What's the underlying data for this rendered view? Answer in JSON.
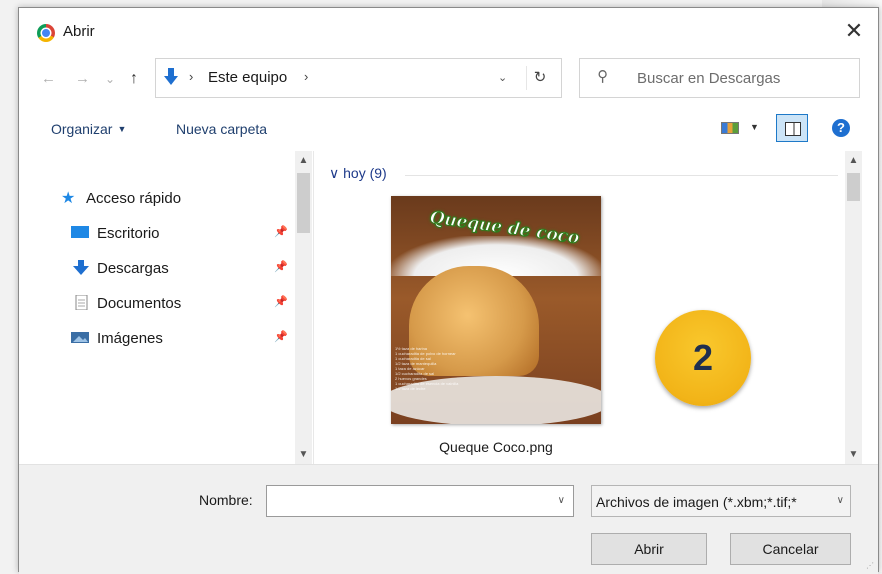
{
  "window": {
    "title": "Abrir",
    "close_glyph": "✕"
  },
  "nav": {
    "back": "←",
    "forward": "→",
    "recent": "⌄",
    "up": "↑"
  },
  "address": {
    "separator": "›",
    "location": "Este equipo",
    "dropdown": "⌄",
    "refresh": "↻"
  },
  "search": {
    "placeholder": "Buscar en Descargas",
    "icon": "search-icon"
  },
  "toolbar": {
    "organize": "Organizar",
    "new_folder": "Nueva carpeta",
    "help": "?"
  },
  "sidebar": {
    "quick_access": "Acceso rápido",
    "items": [
      {
        "label": "Escritorio",
        "icon": "desktop-icon",
        "color": "#1e88e5"
      },
      {
        "label": "Descargas",
        "icon": "download-icon",
        "color": "#1e6fd0"
      },
      {
        "label": "Documentos",
        "icon": "document-icon",
        "color": "#9e9e9e"
      },
      {
        "label": "Imágenes",
        "icon": "pictures-icon",
        "color": "#3a6ea5"
      }
    ]
  },
  "files": {
    "group_label": "hoy (9)",
    "items": [
      {
        "name": "Queque Coco.png",
        "thumbnail_title": "Queque de coco",
        "thumbnail_lines": [
          "1½ taza de harina",
          "1 cucharadita de polvo de hornear",
          "1 cucharadita de sal",
          "1/2 taza de mantequilla",
          "1 taza de azúcar",
          "1/2 cucharadita de sal",
          "2 huevos grandes",
          "1 cucharadita de esencia de vainilla",
          "1/2 taza de leche"
        ]
      }
    ]
  },
  "annotation": {
    "badge": "2"
  },
  "footer": {
    "name_label": "Nombre:",
    "name_value": "",
    "filter": "Archivos de imagen (*.xbm;*.tif;*",
    "open": "Abrir",
    "cancel": "Cancelar"
  },
  "colors": {
    "accent": "#1e6fd0",
    "badge": "#f2b418",
    "badge_text": "#1f2f4f"
  }
}
